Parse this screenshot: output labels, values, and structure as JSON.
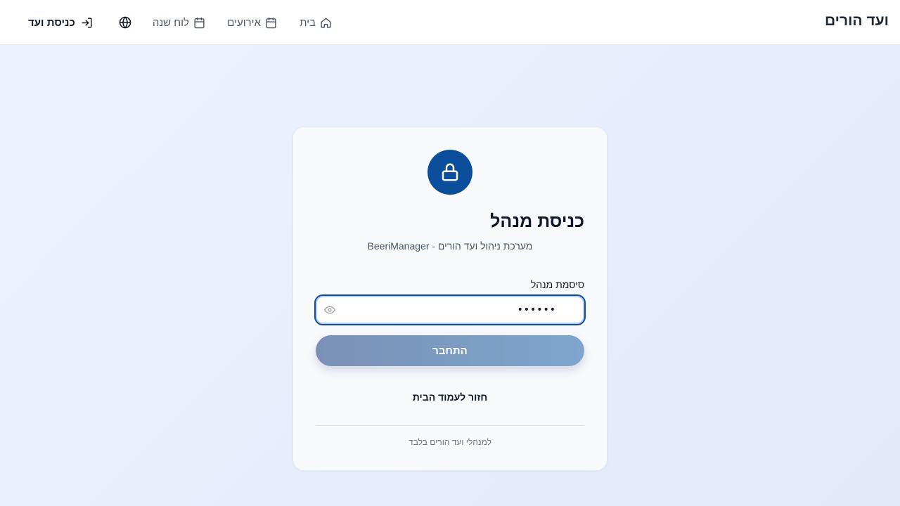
{
  "header": {
    "brand": "ועד הורים",
    "nav": {
      "home": "בית",
      "events": "אירועים",
      "calendar": "לוח שנה"
    },
    "login_label": "כניסת ועד"
  },
  "login_card": {
    "title": "כניסת מנהל",
    "subtitle": "מערכת ניהול ועד הורים - BeeriManager",
    "password_label": "סיסמת מנהל",
    "password_value": "••••••",
    "submit_label": "התחבר",
    "back_link": "חזור לעמוד הבית",
    "footer_note": "למנהלי ועד הורים בלבד"
  },
  "colors": {
    "accent": "#0b4f9c",
    "button_gradient_start": "#7b90b6",
    "button_gradient_end": "#7ea6ce"
  },
  "icons": {
    "home": "home-icon",
    "events": "calendar-icon",
    "calendar": "calendar-icon",
    "language": "globe-icon",
    "login": "login-icon",
    "lock": "lock-icon",
    "show_password": "eye-icon"
  }
}
